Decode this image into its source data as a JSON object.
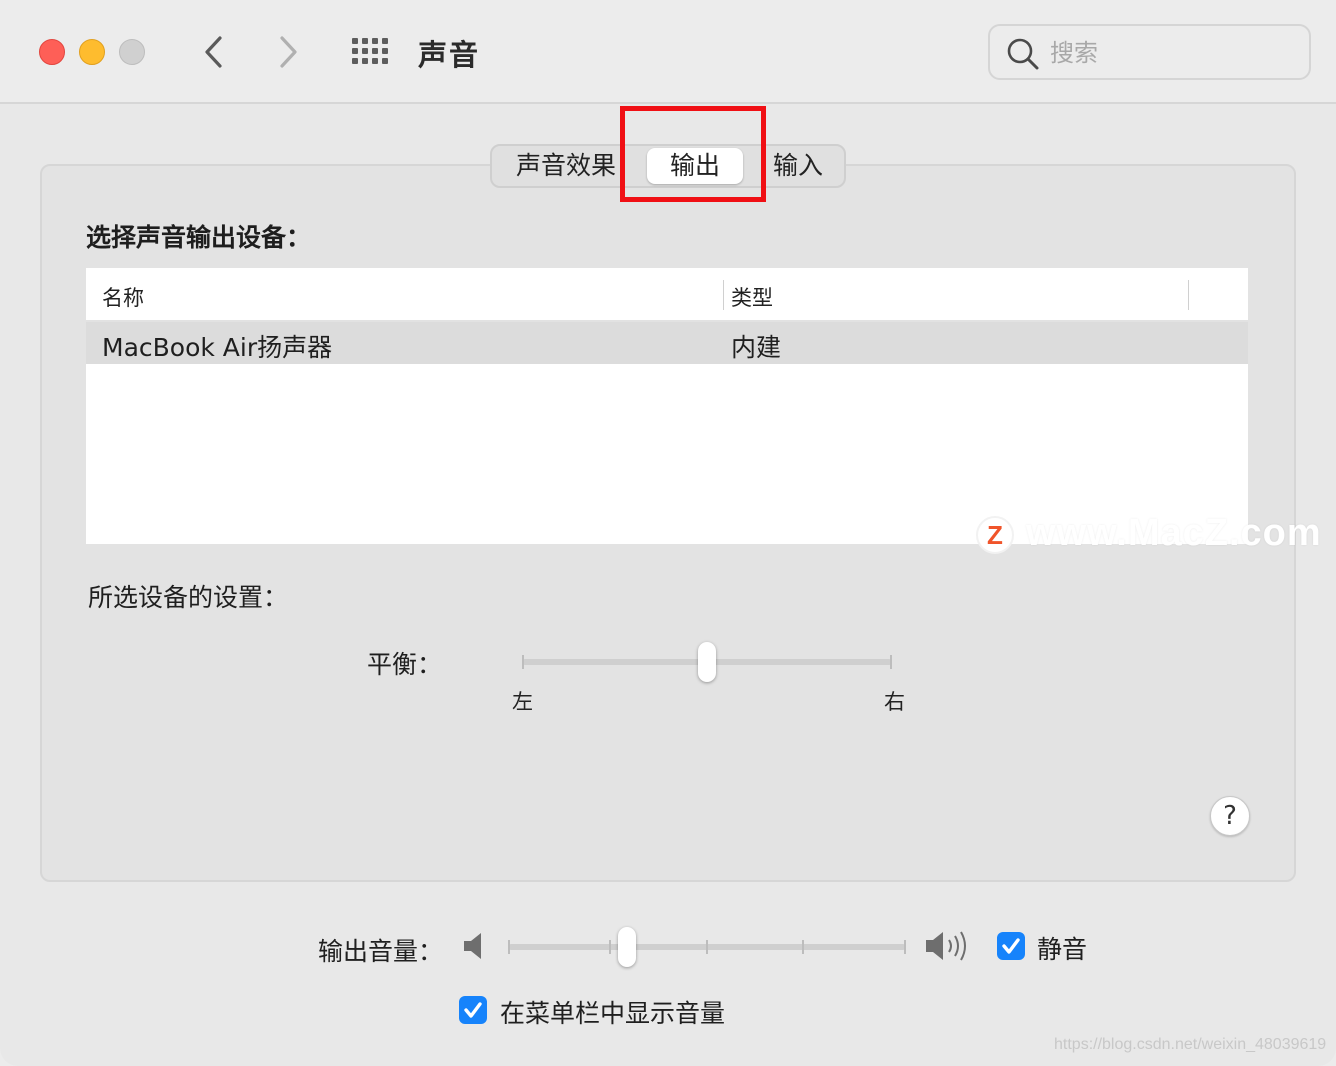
{
  "window": {
    "title": "声音"
  },
  "search": {
    "placeholder": "搜索"
  },
  "tabs": [
    {
      "label": "声音效果",
      "selected": false
    },
    {
      "label": "输出",
      "selected": true
    },
    {
      "label": "输入",
      "selected": false
    }
  ],
  "output": {
    "section_label": "选择声音输出设备：",
    "columns": [
      "名称",
      "类型"
    ],
    "devices": [
      {
        "name": "MacBook Air扬声器",
        "type": "内建",
        "selected": true
      }
    ]
  },
  "settings": {
    "label": "所选设备的设置：",
    "balance_label": "平衡：",
    "balance_left": "左",
    "balance_right": "右",
    "balance_value": 0.5
  },
  "help": {
    "label": "?"
  },
  "volume": {
    "label": "输出音量：",
    "value": 0.3,
    "mute_label": "静音",
    "mute_checked": true
  },
  "menubar": {
    "label": "在菜单栏中显示音量",
    "checked": true
  },
  "watermark": {
    "logo": "Z",
    "text": "www.MacZ.com",
    "csdn": "https://blog.csdn.net/weixin_48039619"
  },
  "colors": {
    "accent": "#1683fb",
    "highlight": "#f00f14",
    "close": "#fe5f57",
    "minimize": "#febc2e"
  }
}
